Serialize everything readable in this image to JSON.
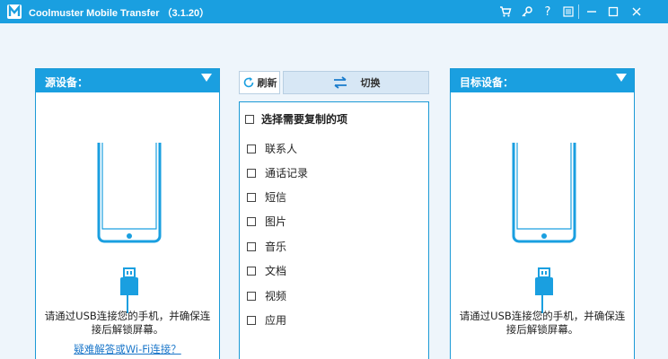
{
  "window": {
    "title": "Coolmuster Mobile Transfer （3.1.20）",
    "controls": {
      "cart": "🛒",
      "key": "⚷",
      "help": "?",
      "feedback": "☰",
      "minimize": "—",
      "maximize": "☐",
      "close": "✕"
    }
  },
  "source_panel": {
    "label": "源设备：",
    "connect_text_line1": "请通过USB连接您的手机，并确保连",
    "connect_text_line2": "接后解锁屏幕。",
    "wifi_link": "疑难解答或Wi-Fi连接？"
  },
  "target_panel": {
    "label": "目标设备：",
    "connect_text_line1": "请通过USB连接您的手机，并确保连",
    "connect_text_line2": "接后解锁屏幕。"
  },
  "toolbar": {
    "refresh_label": "刷新",
    "switch_label": "切换"
  },
  "content_list": {
    "header": "选择需要复制的项",
    "items": [
      "联系人",
      "通话记录",
      "短信",
      "图片",
      "音乐",
      "文档",
      "视频",
      "应用"
    ]
  },
  "colors": {
    "accent": "#1a9fe0",
    "panel_border": "#1c9ad6",
    "background": "#eef5fb",
    "link": "#1a76c9"
  }
}
